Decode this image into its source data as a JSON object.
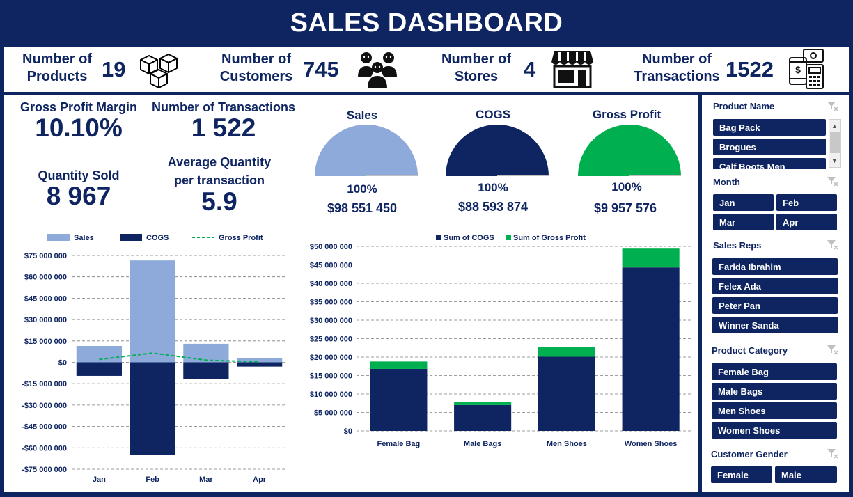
{
  "header": {
    "title": "SALES DASHBOARD"
  },
  "kpis": [
    {
      "label_line1": "Number of",
      "label_line2": "Products",
      "value": "19",
      "icon": "boxes-icon"
    },
    {
      "label_line1": "Number of",
      "label_line2": "Customers",
      "value": "745",
      "icon": "customers-icon"
    },
    {
      "label_line1": "Number of",
      "label_line2": "Stores",
      "value": "4",
      "icon": "store-icon"
    },
    {
      "label_line1": "Number of",
      "label_line2": "Transactions",
      "value": "1522",
      "icon": "payment-icon"
    }
  ],
  "stats": {
    "gross_profit_margin_label": "Gross Profit Margin",
    "gross_profit_margin_value": "10.10%",
    "transactions_label": "Number of Transactions",
    "transactions_value": "1 522",
    "quantity_label": "Quantity Sold",
    "quantity_value": "8 967",
    "avg_qty_label_line1": "Average Quantity",
    "avg_qty_label_line2": "per transaction",
    "avg_qty_value": "5.9"
  },
  "gauges": [
    {
      "title": "Sales",
      "percent": "100%",
      "amount": "$98 551 450",
      "color": "#8eaadb",
      "fill": 1.0
    },
    {
      "title": "COGS",
      "percent": "100%",
      "amount": "$88 593 874",
      "color": "#0f2562",
      "fill": 1.0
    },
    {
      "title": "Gross Profit",
      "percent": "100%",
      "amount": "$9 957 576",
      "color": "#00b050",
      "fill": 1.0
    }
  ],
  "slicers": {
    "product_name": {
      "title": "Product Name",
      "items": [
        "Bag Pack",
        "Brogues",
        "Calf Boots Men"
      ]
    },
    "month": {
      "title": "Month",
      "items": [
        "Jan",
        "Feb",
        "Mar",
        "Apr"
      ]
    },
    "sales_reps": {
      "title": "Sales Reps",
      "items": [
        "Farida Ibrahim",
        "Felex Ada",
        "Peter Pan",
        "Winner Sanda"
      ]
    },
    "product_category": {
      "title": "Product Category",
      "items": [
        "Female Bag",
        "Male Bags",
        "Men Shoes",
        "Women Shoes"
      ]
    },
    "customer_gender": {
      "title": "Customer Gender",
      "items": [
        "Female",
        "Male"
      ]
    }
  },
  "chart_data": [
    {
      "type": "bar",
      "categories": [
        "Jan",
        "Feb",
        "Mar",
        "Apr"
      ],
      "series": [
        {
          "name": "Sales",
          "type": "bar",
          "color": "#8eaadb",
          "values": [
            11500000,
            71500000,
            13000000,
            3000000
          ]
        },
        {
          "name": "COGS",
          "type": "bar",
          "color": "#0f2562",
          "values": [
            -9500000,
            -65000000,
            -11500000,
            -3000000
          ]
        },
        {
          "name": "Gross Profit",
          "type": "line",
          "style": "dashed",
          "color": "#00b050",
          "values": [
            2000000,
            6500000,
            1500000,
            300000
          ]
        }
      ],
      "ylim": [
        -75000000,
        75000000
      ],
      "yticks": [
        75000000,
        60000000,
        45000000,
        30000000,
        15000000,
        0,
        -15000000,
        -30000000,
        -45000000,
        -60000000,
        -75000000
      ],
      "ytick_labels": [
        "$75 000 000",
        "$60 000 000",
        "$45 000 000",
        "$30 000 000",
        "$15 000 000",
        "$0",
        "-$15 000 000",
        "-$30 000 000",
        "-$45 000 000",
        "-$60 000 000",
        "-$75 000 000"
      ],
      "legend": "top",
      "grid": true
    },
    {
      "type": "bar",
      "stacked": true,
      "categories": [
        "Female Bag",
        "Male Bags",
        "Men Shoes",
        "Women Shoes"
      ],
      "series": [
        {
          "name": "Sum of COGS",
          "color": "#0f2562",
          "values": [
            16800000,
            7000000,
            20100000,
            44300000
          ]
        },
        {
          "name": "Sum of Gross Profit",
          "color": "#00b050",
          "values": [
            2000000,
            800000,
            2700000,
            5100000
          ]
        }
      ],
      "ylim": [
        0,
        50000000
      ],
      "yticks": [
        50000000,
        45000000,
        40000000,
        35000000,
        30000000,
        25000000,
        20000000,
        15000000,
        10000000,
        5000000,
        0
      ],
      "ytick_labels": [
        "$50 000 000",
        "$45 000 000",
        "$40 000 000",
        "$35 000 000",
        "$30 000 000",
        "$25 000 000",
        "$20 000 000",
        "$15 000 000",
        "$10 000 000",
        "$5 000 000",
        "$0"
      ],
      "legend": "top",
      "grid": true
    }
  ]
}
